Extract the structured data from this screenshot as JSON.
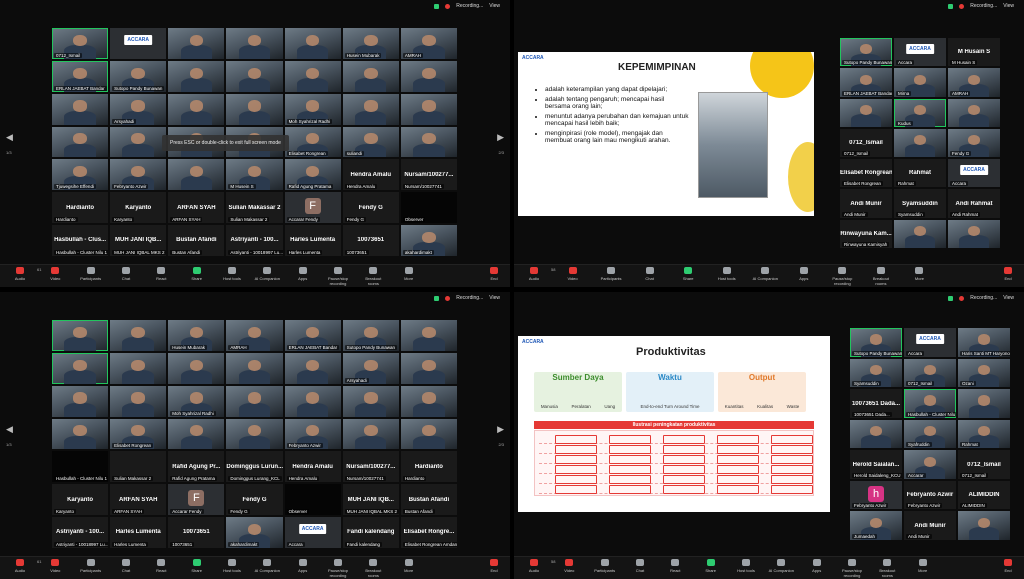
{
  "topbar": {
    "recording": "Recording...",
    "view": "View"
  },
  "toolbar": {
    "q1": [
      "Audio",
      "Video",
      "Participants",
      "Chat",
      "React",
      "Share",
      "Host tools",
      "AI Companion",
      "Apps",
      "Pause/stop recording",
      "Breakout rooms",
      "More",
      "End"
    ],
    "q2": [
      "Audio",
      "Video",
      "Participants",
      "Chat",
      "Share",
      "Host tools",
      "AI Companion",
      "Apps",
      "Pause/stop recording",
      "Breakout rooms",
      "More",
      "End"
    ],
    "q3": [
      "Audio",
      "Video",
      "Participants",
      "Chat",
      "React",
      "Share",
      "Host tools",
      "AI Companion",
      "Apps",
      "Pause/stop recording",
      "Breakout rooms",
      "More",
      "End"
    ],
    "q4": [
      "Audio",
      "Video",
      "Participants",
      "Chat",
      "React",
      "Share",
      "Host tools",
      "AI Companion",
      "Apps",
      "Pause/stop recording",
      "Breakout rooms",
      "More",
      "End"
    ],
    "participant_counts": {
      "q1": "61",
      "q2": "58",
      "q3": "61",
      "q4": "58"
    }
  },
  "esc_hint": "Press ESC or double-click to exit full screen mode",
  "page_indicators": {
    "q1_left": "1/3",
    "q1_right": "2/3",
    "q3_left": "1/3",
    "q3_right": "2/3"
  },
  "q1_tiles": [
    {
      "n": "0712_Ismail",
      "t": "cam"
    },
    {
      "n": "",
      "t": "logo",
      "logo": "ACCARA"
    },
    {
      "n": "",
      "t": "cam"
    },
    {
      "n": "",
      "t": "cam"
    },
    {
      "n": "",
      "t": "cam"
    },
    {
      "n": "Husein Mubarak",
      "t": "cam"
    },
    {
      "n": "AMRAH",
      "t": "cam"
    },
    {
      "n": "ERLAN JAEBAT Bandar",
      "t": "cam"
    },
    {
      "n": "Sutopo Pandy Bunawan",
      "t": "cam"
    },
    {
      "n": "",
      "t": "cam"
    },
    {
      "n": "",
      "t": "cam"
    },
    {
      "n": "",
      "t": "cam"
    },
    {
      "n": "",
      "t": "cam"
    },
    {
      "n": "",
      "t": "cam"
    },
    {
      "n": "",
      "t": "cam"
    },
    {
      "n": "Arsyahadi",
      "t": "cam"
    },
    {
      "n": "",
      "t": "cam"
    },
    {
      "n": "",
      "t": "cam"
    },
    {
      "n": "Moh Syahrizal Radhi",
      "t": "cam"
    },
    {
      "n": "",
      "t": "cam"
    },
    {
      "n": "",
      "t": "cam"
    },
    {
      "n": "",
      "t": "cam"
    },
    {
      "n": "",
      "t": "cam"
    },
    {
      "n": "",
      "t": "cam"
    },
    {
      "n": "",
      "t": "cam"
    },
    {
      "n": "Elisabet Rongrean",
      "t": "cam"
    },
    {
      "n": "suliandi",
      "t": "cam"
    },
    {
      "n": "",
      "t": "cam"
    },
    {
      "n": "Tjuwegsihe Effendi",
      "t": "cam"
    },
    {
      "n": "Febryanto Azwir",
      "t": "cam"
    },
    {
      "n": "",
      "t": "cam"
    },
    {
      "n": "M Husein S",
      "t": "cam"
    },
    {
      "n": "Rafid Agung Pratama",
      "t": "cam"
    },
    {
      "n": "Hendra Amalu",
      "big": "Hendra Amalu",
      "t": "txt"
    },
    {
      "n": "Nursam/10027741",
      "big": "Nursam/100277...",
      "t": "txt"
    },
    {
      "n": "Hardianto",
      "big": "Hardianto",
      "t": "txt"
    },
    {
      "n": "Karyanto",
      "big": "Karyanto",
      "t": "txt"
    },
    {
      "n": "ARFAN SYAH",
      "big": "ARFAN SYAH",
      "t": "txt"
    },
    {
      "n": "Sulian Makassar 2",
      "big": "Sulian Makassar 2",
      "t": "txt"
    },
    {
      "n": "Accarar Fendy",
      "t": "avatar",
      "av": "F"
    },
    {
      "n": "Fendy G",
      "big": "Fendy G",
      "t": "txt"
    },
    {
      "n": "Observer",
      "t": "black"
    },
    {
      "n": "Hasbullah - Cluster Nilu 1",
      "big": "Hasbullah - Clus...",
      "t": "txt"
    },
    {
      "n": "MUH JANI IQBAL MKS 2",
      "big": "MUH JANI IQB...",
      "t": "txt"
    },
    {
      "n": "Bustan Afandi",
      "big": "Bustan Afandi",
      "t": "txt"
    },
    {
      "n": "Astriyanti - 10018997 Lu...",
      "big": "Astriyanti - 100...",
      "t": "txt"
    },
    {
      "n": "Harles Lumenta",
      "big": "Harles Lumenta",
      "t": "txt"
    },
    {
      "n": "10073651",
      "big": "10073651",
      "t": "txt"
    },
    {
      "n": "akahardimakt",
      "t": "cam"
    }
  ],
  "q2_slide": {
    "logo": "ACCARA",
    "title": "KEPEMIMPINAN",
    "bullets": [
      "adalah keterampilan yang dapat dipelajari;",
      "adalah tentang pengaruh; mencapai hasil bersama orang lain;",
      "menuntut adanya perubahan dan kemajuan untuk mencapai hasil lebih baik;",
      "menginpirasi (role model), mengajak dan membuat orang lain mau mengikuti arahan."
    ]
  },
  "q2_tiles": [
    {
      "n": "Sutopo Pandy Bunawan",
      "t": "cam"
    },
    {
      "n": "Accara",
      "t": "logo",
      "logo": "ACCARA"
    },
    {
      "n": "M Husain S",
      "big": "M Husain S",
      "t": "txt"
    },
    {
      "n": "ERLAN JAEBAT Bandar",
      "t": "cam"
    },
    {
      "n": "Mirna",
      "t": "cam"
    },
    {
      "n": "AMRAH",
      "t": "cam"
    },
    {
      "n": "",
      "t": "cam"
    },
    {
      "n": "Kudus",
      "t": "cam"
    },
    {
      "n": "",
      "t": "cam"
    },
    {
      "n": "0712_Ismail",
      "big": "0712_Ismail",
      "t": "txt"
    },
    {
      "n": "",
      "t": "cam"
    },
    {
      "n": "Fendy G",
      "t": "cam"
    },
    {
      "n": "Elisabet Rongrean",
      "big": "Elisabet Rongrean",
      "t": "txt"
    },
    {
      "n": "Rahmat",
      "big": "Rahmat",
      "t": "txt"
    },
    {
      "n": "Accara",
      "t": "logo",
      "logo": "ACCARA"
    },
    {
      "n": "Andi Munir",
      "big": "Andi Munir",
      "t": "txt"
    },
    {
      "n": "Syamsuddin",
      "big": "Syamsuddin",
      "t": "txt"
    },
    {
      "n": "Andi Rahmat",
      "big": "Andi Rahmat",
      "t": "txt"
    },
    {
      "n": "Rinwayuna Kamisyah",
      "big": "Rinwayuna Kam...",
      "t": "txt"
    },
    {
      "n": "",
      "t": "cam"
    },
    {
      "n": "",
      "t": "cam"
    }
  ],
  "q3_tiles": [
    {
      "n": "",
      "t": "cam"
    },
    {
      "n": "",
      "t": "cam"
    },
    {
      "n": "Husein Mubarak",
      "t": "cam"
    },
    {
      "n": "AMRAH",
      "t": "cam"
    },
    {
      "n": "ERLAN JAEBAT Bandar",
      "t": "cam"
    },
    {
      "n": "Sutopo Pandy Bunawan",
      "t": "cam"
    },
    {
      "n": "",
      "t": "cam"
    },
    {
      "n": "",
      "t": "cam"
    },
    {
      "n": "",
      "t": "cam"
    },
    {
      "n": "",
      "t": "cam"
    },
    {
      "n": "",
      "t": "cam"
    },
    {
      "n": "",
      "t": "cam"
    },
    {
      "n": "Arsyahadi",
      "t": "cam"
    },
    {
      "n": "",
      "t": "cam"
    },
    {
      "n": "",
      "t": "cam"
    },
    {
      "n": "",
      "t": "cam"
    },
    {
      "n": "Moh Syahrizal Radhi",
      "t": "cam"
    },
    {
      "n": "",
      "t": "cam"
    },
    {
      "n": "",
      "t": "cam"
    },
    {
      "n": "",
      "t": "cam"
    },
    {
      "n": "",
      "t": "cam"
    },
    {
      "n": "",
      "t": "cam"
    },
    {
      "n": "Elisabet Rongrean",
      "t": "cam"
    },
    {
      "n": "",
      "t": "cam"
    },
    {
      "n": "",
      "t": "cam"
    },
    {
      "n": "Febryanto Azwir",
      "t": "cam"
    },
    {
      "n": "",
      "t": "cam"
    },
    {
      "n": "",
      "t": "cam"
    },
    {
      "n": "Hasbullah - Cluster Nilu 1",
      "t": "black"
    },
    {
      "n": "Sulian Makassar 2",
      "t": "txt",
      "big": ""
    },
    {
      "n": "Rafid Agung Pratama",
      "big": "Rafid Agung Pr...",
      "t": "txt"
    },
    {
      "n": "Dominggus Lurang_KCL",
      "big": "Dominggus Lurun...",
      "t": "txt"
    },
    {
      "n": "Hendra Amalu",
      "big": "Hendra Amalu",
      "t": "txt"
    },
    {
      "n": "Nursam/10027741",
      "big": "Nursam/100277...",
      "t": "txt"
    },
    {
      "n": "Hardianto",
      "big": "Hardianto",
      "t": "txt"
    },
    {
      "n": "Karyanto",
      "big": "Karyanto",
      "t": "txt"
    },
    {
      "n": "ARFAN SYAH",
      "big": "ARFAN SYAH",
      "t": "txt"
    },
    {
      "n": "Accarar Fendy",
      "t": "avatar",
      "av": "F"
    },
    {
      "n": "Fendy G",
      "big": "Fendy G",
      "t": "txt"
    },
    {
      "n": "Observer",
      "t": "black"
    },
    {
      "n": "MUH JANI IQBAL MKS 2",
      "big": "MUH JANI IQB...",
      "t": "txt"
    },
    {
      "n": "Bustan Afandi",
      "big": "Bustan Afandi",
      "t": "txt"
    },
    {
      "n": "Astriyanti - 10018997 Lu...",
      "big": "Astriyanti - 100...",
      "t": "txt"
    },
    {
      "n": "Harles Lumenta",
      "big": "Harles Lumenta",
      "t": "txt"
    },
    {
      "n": "10073651",
      "big": "10073651",
      "t": "txt"
    },
    {
      "n": "akahardimakt",
      "t": "cam"
    },
    {
      "n": "Accara",
      "t": "logo",
      "logo": "ACCARA"
    },
    {
      "n": "Fandi kalendang",
      "big": "Fandi kalendang",
      "t": "txt"
    },
    {
      "n": "Elisabet Rongrean Amdani",
      "big": "Elisabet Rongre...",
      "t": "txt"
    }
  ],
  "q4_slide": {
    "logo": "ACCARA",
    "title": "Produktivitas",
    "cards": [
      {
        "title": "Sumber Daya",
        "items": [
          "Manusia",
          "Peralatan",
          "Uang"
        ],
        "bg": "#e6f2e0",
        "color": "#3c8c2c"
      },
      {
        "title": "Waktu",
        "items": [
          "End-to-end Turn Around Time"
        ],
        "bg": "#e3f0f8",
        "color": "#2a88c6"
      },
      {
        "title": "Output",
        "items": [
          "Kuantitas",
          "Kualitas",
          "Waste"
        ],
        "bg": "#fbe8d8",
        "color": "#e0792a"
      }
    ],
    "band": "Ilustrasi peningkatan produktivitas"
  },
  "q4_tiles": [
    {
      "n": "Sutopo Pandy Bunawan",
      "t": "cam"
    },
    {
      "n": "Accara",
      "t": "logo",
      "logo": "ACCARA"
    },
    {
      "n": "Haris Santi MT Haryono",
      "t": "cam"
    },
    {
      "n": "Syamsuddin",
      "t": "cam"
    },
    {
      "n": "0712_Ismail",
      "t": "cam"
    },
    {
      "n": "Ozani",
      "t": "cam"
    },
    {
      "n": "10073651 Dada...",
      "big": "10073651 Dada...",
      "t": "txt"
    },
    {
      "n": "Hasbullah - Cluster Nilu 1",
      "t": "cam"
    },
    {
      "n": "",
      "t": "cam"
    },
    {
      "n": "",
      "t": "cam"
    },
    {
      "n": "Syafruddin",
      "t": "cam"
    },
    {
      "n": "Rahmat",
      "t": "cam"
    },
    {
      "n": "Herold Saidaleng_KCU",
      "big": "Herold Saialan...",
      "t": "txt"
    },
    {
      "n": "Accarar",
      "t": "cam"
    },
    {
      "n": "0712_Ismail",
      "big": "0712_Ismail",
      "t": "txt"
    },
    {
      "n": "Febryanto Azwir",
      "t": "avatar",
      "av": "h",
      "h": true
    },
    {
      "n": "Febryanto Azwir",
      "big": "Febryanto Azwir",
      "t": "txt"
    },
    {
      "n": "ALIMIDDIN",
      "big": "ALIMIDDIN",
      "t": "txt"
    },
    {
      "n": "Jumaedah",
      "t": "cam"
    },
    {
      "n": "Andi Munir",
      "big": "Andi Munir",
      "t": "txt"
    },
    {
      "n": "",
      "t": "cam"
    }
  ]
}
